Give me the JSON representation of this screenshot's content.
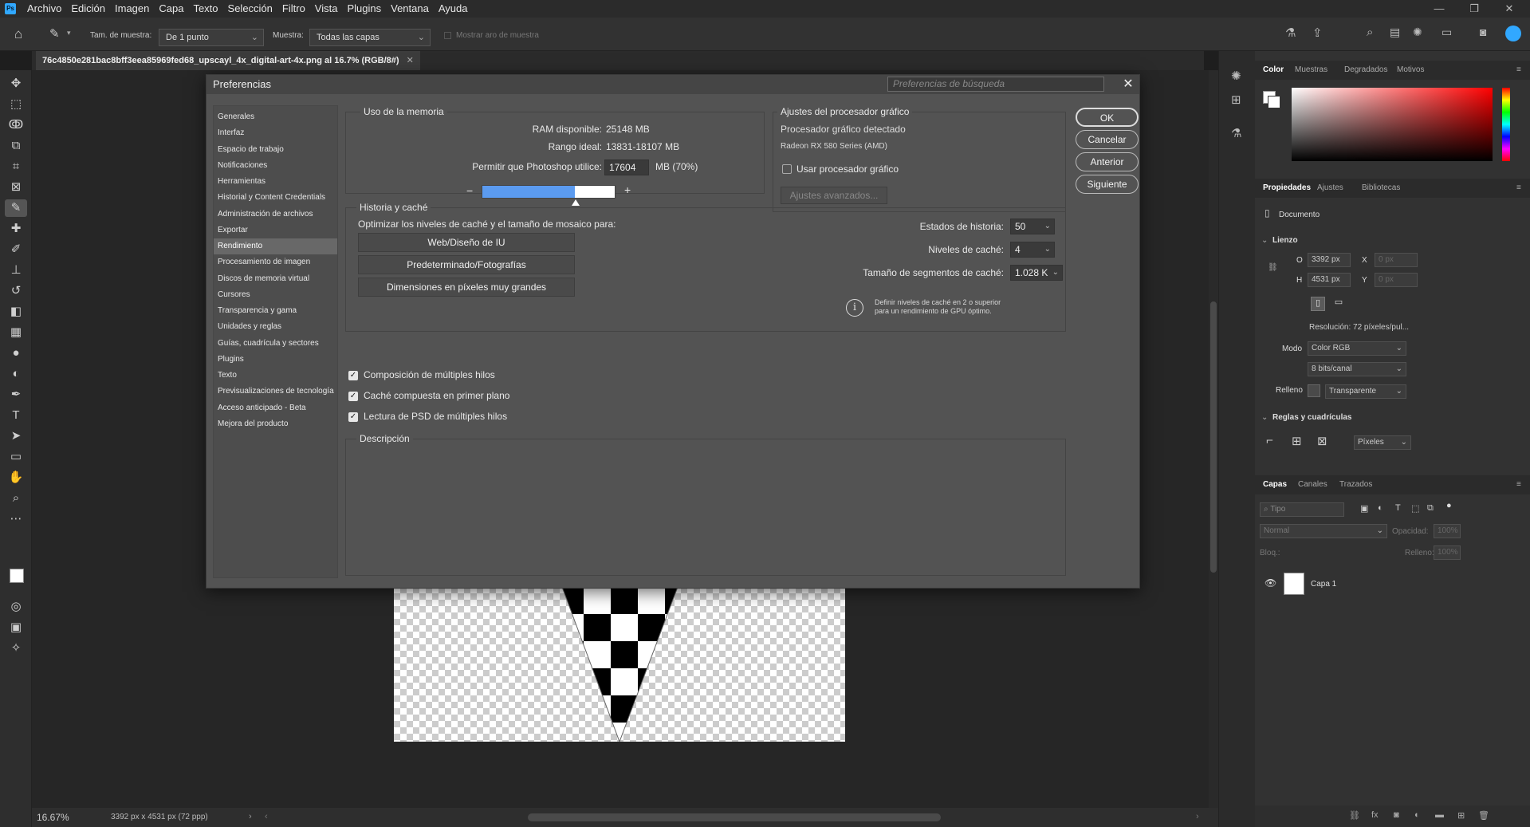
{
  "menubar": {
    "items": [
      "Archivo",
      "Edición",
      "Imagen",
      "Capa",
      "Texto",
      "Selección",
      "Filtro",
      "Vista",
      "Plugins",
      "Ventana",
      "Ayuda"
    ],
    "logo": "Ps"
  },
  "options": {
    "sample_size_label": "Tam. de muestra:",
    "sample_size_value": "De 1 punto",
    "sample_label": "Muestra:",
    "sample_value": "Todas las capas",
    "show_ring_label": "Mostrar aro de muestra"
  },
  "doc": {
    "tab_title": "76c4850e281bac8bff3eea85969fed68_upscayl_4x_digital-art-4x.png al 16.7% (RGB/8#)",
    "zoom": "16.67%",
    "dims": "3392 px x 4531 px (72 ppp)"
  },
  "dialog": {
    "title": "Preferencias",
    "search_placeholder": "Preferencias de búsqueda",
    "categories": [
      "Generales",
      "Interfaz",
      "Espacio de trabajo",
      "Notificaciones",
      "Herramientas",
      "Historial y Content Credentials",
      "Administración de archivos",
      "Exportar",
      "Rendimiento",
      "Procesamiento de imagen",
      "Discos de memoria virtual",
      "Cursores",
      "Transparencia y gama",
      "Unidades y reglas",
      "Guías, cuadrícula y sectores",
      "Plugins",
      "Texto",
      "Previsualizaciones de tecnología",
      "Acceso anticipado - Beta",
      "Mejora del producto"
    ],
    "selected_category": "Rendimiento",
    "memory": {
      "title": "Uso de la memoria",
      "ram_label": "RAM disponible:",
      "ram_value": "25148 MB",
      "ideal_label": "Rango ideal:",
      "ideal_value": "13831-18107 MB",
      "allow_label": "Permitir que Photoshop utilice:",
      "allow_value": "17604",
      "allow_unit": "MB (70%)",
      "slider_fraction": 0.7,
      "minus": "−",
      "plus": "+"
    },
    "gpu": {
      "title": "Ajustes del procesador gráfico",
      "detected_label": "Procesador gráfico detectado",
      "gpu_name": "Radeon RX 580 Series (AMD)",
      "use_gpu_label": "Usar procesador gráfico",
      "use_gpu_checked": false,
      "advanced_button": "Ajustes avanzados..."
    },
    "buttons": {
      "ok": "OK",
      "cancel": "Cancelar",
      "prev": "Anterior",
      "next": "Siguiente"
    },
    "history": {
      "title": "Historia y caché",
      "optimize_label": "Optimizar los niveles de caché y el tamaño de mosaico para:",
      "preset1": "Web/Diseño de IU",
      "preset2": "Predeterminado/Fotografías",
      "preset3": "Dimensiones en píxeles muy grandes",
      "states_label": "Estados de historia:",
      "states_value": "50",
      "levels_label": "Niveles de caché:",
      "levels_value": "4",
      "tile_label": "Tamaño de segmentos de caché:",
      "tile_value": "1.028 K",
      "info_text": "Definir niveles de caché en 2 o superior para un rendimiento de GPU óptimo."
    },
    "options": {
      "multithread_comp": "Composición de múltiples hilos",
      "foreground_cache": "Caché compuesta en primer plano",
      "multithread_psd": "Lectura de PSD de múltiples hilos"
    },
    "description_title": "Descripción"
  },
  "panels": {
    "color_tabs": [
      "Color",
      "Muestras",
      "Degradados",
      "Motivos"
    ],
    "prop_tabs": [
      "Propiedades",
      "Ajustes",
      "Bibliotecas"
    ],
    "document_label": "Documento",
    "canvas_title": "Lienzo",
    "w_label": "O",
    "w_value": "3392 px",
    "h_label": "H",
    "h_value": "4531 px",
    "x_label": "X",
    "x_value": "0 px",
    "y_label": "Y",
    "y_value": "0 px",
    "resolution": "Resolución:  72 píxeles/pul...",
    "mode_label": "Modo",
    "mode_value": "Color RGB",
    "depth_value": "8 bits/canal",
    "fill_label": "Relleno",
    "fill_value": "Transparente",
    "rulers_title": "Reglas y cuadrículas",
    "units_value": "Píxeles",
    "layer_tabs": [
      "Capas",
      "Canales",
      "Trazados"
    ],
    "filter_placeholder": "Tipo",
    "blend_value": "Normal",
    "opacity_label": "Opacidad:",
    "opacity_value": "100%",
    "lock_label": "Bloq.:",
    "fill2_label": "Relleno:",
    "fill2_value": "100%",
    "layer_name": "Capa 1"
  },
  "colors": {
    "accent": "#31a8ff",
    "slider_fill": "#5b9bf0"
  }
}
